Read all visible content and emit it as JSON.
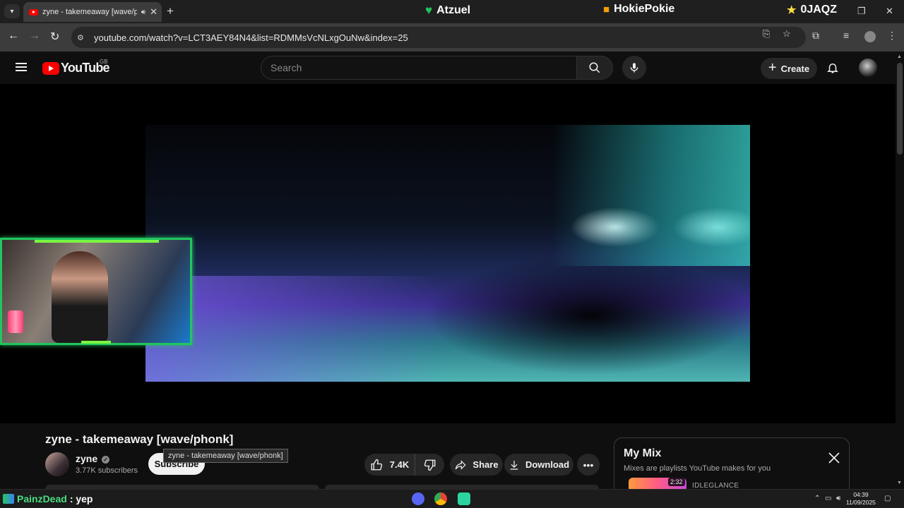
{
  "browser": {
    "tab_title": "zyne - takemeaway [wave/p",
    "url": "youtube.com/watch?v=LCT3AEY84N4&list=RDMMsVcNLxgOuNw&index=25"
  },
  "stream_overlay": {
    "labels": [
      "Atzuel",
      "HokiePokie",
      "0JAQZ"
    ],
    "chat_user": "PainzDead",
    "chat_message": ": yep"
  },
  "youtube": {
    "logo_text": "YouTube",
    "country_code": "GB",
    "search_placeholder": "Search",
    "create_label": "Create"
  },
  "video": {
    "title": "zyne - takemeaway [wave/phonk]",
    "tooltip": "zyne - takemeaway [wave/phonk]",
    "channel": "zyne",
    "subscribers": "3.77K subscribers",
    "subscribe_label": "Subscribe",
    "likes": "7.4K",
    "share_label": "Share",
    "download_label": "Download"
  },
  "mix_panel": {
    "title": "My Mix",
    "subtitle": "Mixes are playlists YouTube makes for you",
    "next_duration": "2:32",
    "next_channel": "IDLEGLANCE"
  },
  "taskbar": {
    "time": "04:39",
    "date": "11/09/2025"
  },
  "colors": {
    "youtube_red": "#ff0000",
    "webcam_border": "#22c55e",
    "background": "#0f0f0f"
  }
}
